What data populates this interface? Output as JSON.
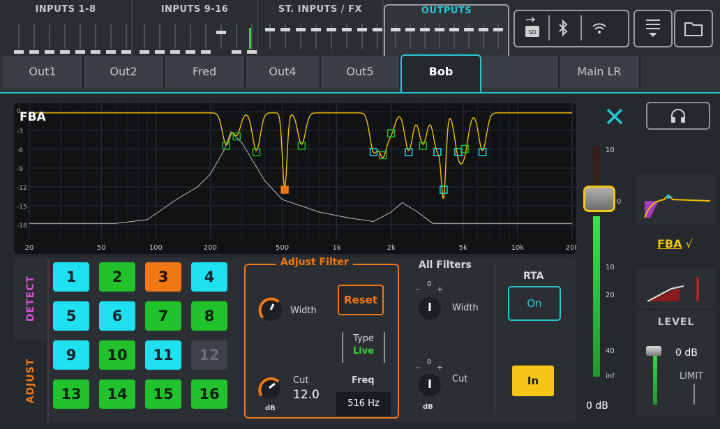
{
  "top_groups": [
    {
      "label": "INPUTS 1-8"
    },
    {
      "label": "INPUTS 9-16"
    },
    {
      "label": "ST. INPUTS / FX"
    },
    {
      "label": "OUTPUTS"
    }
  ],
  "output_tabs": [
    "Out1",
    "Out2",
    "Fred",
    "Out4",
    "Out5",
    "Bob",
    "",
    "Main LR"
  ],
  "active_tab": "Bob",
  "graph": {
    "label": "FBA",
    "y_ticks": [
      "0",
      "-3",
      "-6",
      "-9",
      "-12",
      "-15",
      "-18"
    ],
    "x_ticks": [
      "20",
      "50",
      "100",
      "200",
      "500",
      "1k",
      "2k",
      "5k",
      "10k",
      "20k"
    ]
  },
  "side_tabs": {
    "detect": "DETECT",
    "adjust": "ADJUST"
  },
  "filters": [
    {
      "n": "1",
      "state": "cyan"
    },
    {
      "n": "2",
      "state": "green"
    },
    {
      "n": "3",
      "state": "orange"
    },
    {
      "n": "4",
      "state": "cyan"
    },
    {
      "n": "5",
      "state": "cyan"
    },
    {
      "n": "6",
      "state": "cyan"
    },
    {
      "n": "7",
      "state": "green"
    },
    {
      "n": "8",
      "state": "green"
    },
    {
      "n": "9",
      "state": "cyan"
    },
    {
      "n": "10",
      "state": "green"
    },
    {
      "n": "11",
      "state": "cyan"
    },
    {
      "n": "12",
      "state": "grey"
    },
    {
      "n": "13",
      "state": "green"
    },
    {
      "n": "14",
      "state": "green"
    },
    {
      "n": "15",
      "state": "green"
    },
    {
      "n": "16",
      "state": "green"
    }
  ],
  "adjust": {
    "title": "Adjust Filter",
    "width_label": "Width",
    "reset_label": "Reset",
    "type_label": "Type",
    "type_value": "Live",
    "cut_label": "Cut",
    "cut_value": "12.0",
    "db_label": "dB",
    "freq_label": "Freq",
    "freq_value": "516 Hz"
  },
  "all_filters": {
    "title": "All Filters",
    "width_label": "Width",
    "cut_label": "Cut",
    "db_label": "dB",
    "zero": "0",
    "minus": "–",
    "plus": "+"
  },
  "rta": {
    "title": "RTA",
    "on_label": "On",
    "in_label": "In"
  },
  "fader": {
    "scale": [
      "10",
      "0",
      "10",
      "20",
      "40",
      "inf"
    ],
    "value": "0 dB"
  },
  "right": {
    "fba_label": "FBA",
    "level_title": "LEVEL",
    "level_value": "0 dB",
    "limit_label": "LIMIT"
  },
  "colors": {
    "accent": "#28c7d4",
    "eq_curve": "#f2c200",
    "filter_green": "#22c22c",
    "filter_cyan": "#1ee0f0",
    "filter_orange": "#f07814"
  }
}
